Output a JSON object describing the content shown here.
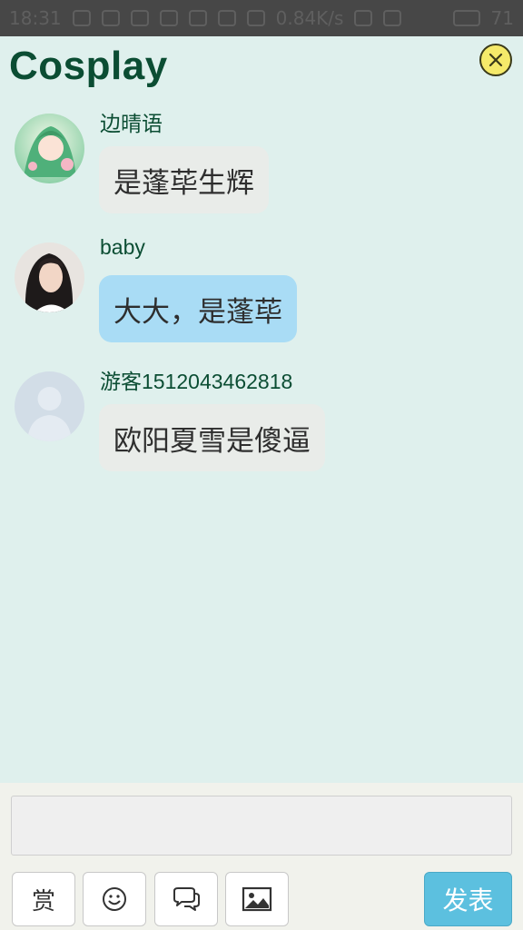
{
  "status_bar": {
    "time": "18:31",
    "speed": "0.84K/s",
    "battery": "71"
  },
  "room": {
    "title": "Cosplay"
  },
  "messages": [
    {
      "user": "边晴语",
      "text": "是蓬荜生辉",
      "bubble": "gray",
      "avatar": "anime-avatar"
    },
    {
      "user": "baby",
      "text": "大大，是蓬荜",
      "bubble": "blue",
      "avatar": "photo-avatar"
    },
    {
      "user": "游客1512043462818",
      "text": "欧阳夏雪是傻逼",
      "bubble": "gray",
      "avatar": "default-avatar"
    }
  ],
  "composer": {
    "reward_label": "赏",
    "send_label": "发表"
  },
  "icons": [
    "close-icon",
    "smiley-icon",
    "chat-bubbles-icon",
    "image-icon"
  ],
  "colors": {
    "background": "#dff0ed",
    "title": "#0b4d33",
    "bubble_gray": "#e9ece9",
    "bubble_blue": "#a9dcf5",
    "send_button": "#5cc0df",
    "close_button": "#f5ea6a"
  }
}
